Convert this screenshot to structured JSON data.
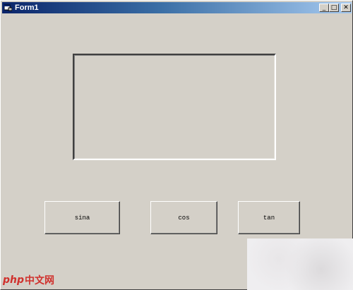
{
  "window": {
    "title": "Form1",
    "min_glyph": "_",
    "max_glyph": "□",
    "close_glyph": "✕"
  },
  "buttons": {
    "sina": "sina",
    "cos": "cos",
    "tan": "tan"
  },
  "watermark": {
    "brand": "php",
    "suffix": "中文网"
  }
}
